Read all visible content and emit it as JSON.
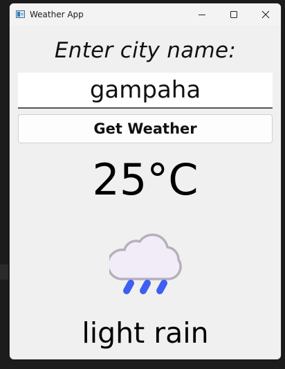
{
  "window": {
    "title": "Weather App"
  },
  "titlebar_icons": {
    "minimize": "minimize-icon",
    "maximize": "maximize-icon",
    "close": "close-icon"
  },
  "form": {
    "prompt_label": "Enter city name:",
    "city_value": "gampaha",
    "get_weather_label": "Get Weather"
  },
  "weather": {
    "temperature": "25°C",
    "icon": "rain-cloud-icon",
    "description": "light rain"
  },
  "colors": {
    "cloud_fill": "#f1ecf7",
    "cloud_outline": "#b5b0b9",
    "rain_drops": "#3f5ef2"
  }
}
